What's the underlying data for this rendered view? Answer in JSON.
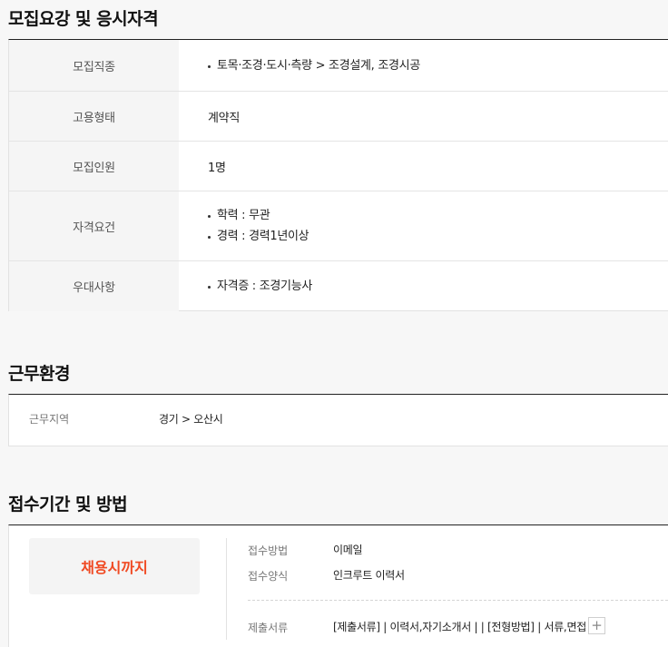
{
  "sections": {
    "requirements": {
      "title": "모집요강 및 응시자격",
      "rows": [
        {
          "label": "모집직종",
          "values": [
            "토목·조경·도시·측량 > 조경설계, 조경시공"
          ]
        },
        {
          "label": "고용형태",
          "value": "계약직"
        },
        {
          "label": "모집인원",
          "value": "1명"
        },
        {
          "label": "자격요건",
          "values": [
            "학력 : 무관",
            "경력 : 경력1년이상"
          ]
        },
        {
          "label": "우대사항",
          "values": [
            "자격증 : 조경기능사"
          ]
        }
      ]
    },
    "environment": {
      "title": "근무환경",
      "location_label": "근무지역",
      "location_value": "경기 > 오산시"
    },
    "application": {
      "title": "접수기간 및 방법",
      "deadline": "채용시까지",
      "method_label": "접수방법",
      "method_value": "이메일",
      "form_label": "접수양식",
      "form_value": "인크루트 이력서",
      "docs_label": "제출서류",
      "docs_value": "[제출서류] | 이력서,자기소개서 | | [전형방법] | 서류,면접",
      "more_symbol": "+"
    }
  }
}
